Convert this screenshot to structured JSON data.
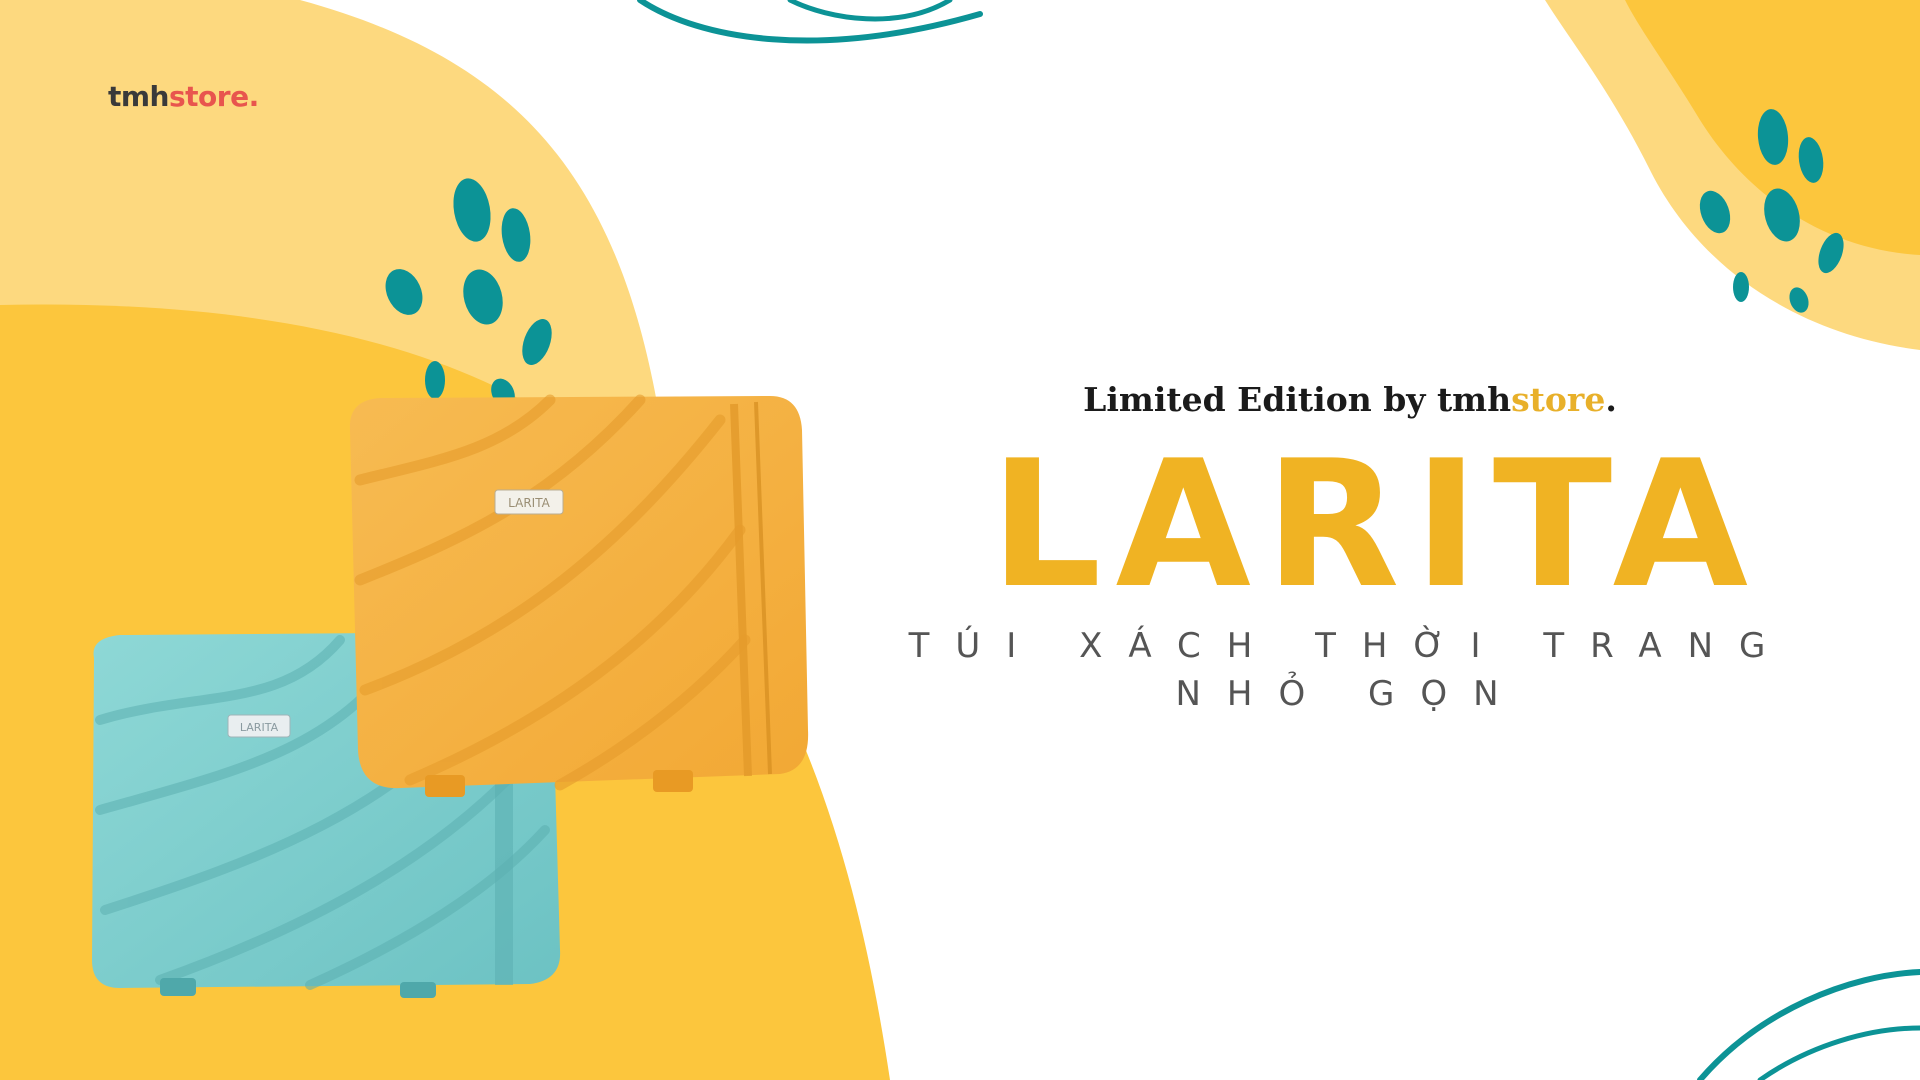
{
  "logo": {
    "part_dark": "tmh",
    "part_accent": "store."
  },
  "tagline": {
    "prefix": "Limited Edition by tmh",
    "highlight": "store",
    "suffix": "."
  },
  "brand_name": "LARITA",
  "subtitle": {
    "line1": "TÚI XÁCH THỜI TRANG",
    "line2": "NHỎ GỌN"
  },
  "product_badge": "LARITA",
  "colors": {
    "yellow": "#fcc63d",
    "light_yellow": "#fdd97f",
    "teal": "#0c9396",
    "brand_text": "#f0b323",
    "accent_red": "#e8554e",
    "case_orange": "#f6b042",
    "case_teal": "#7fcfcf"
  }
}
